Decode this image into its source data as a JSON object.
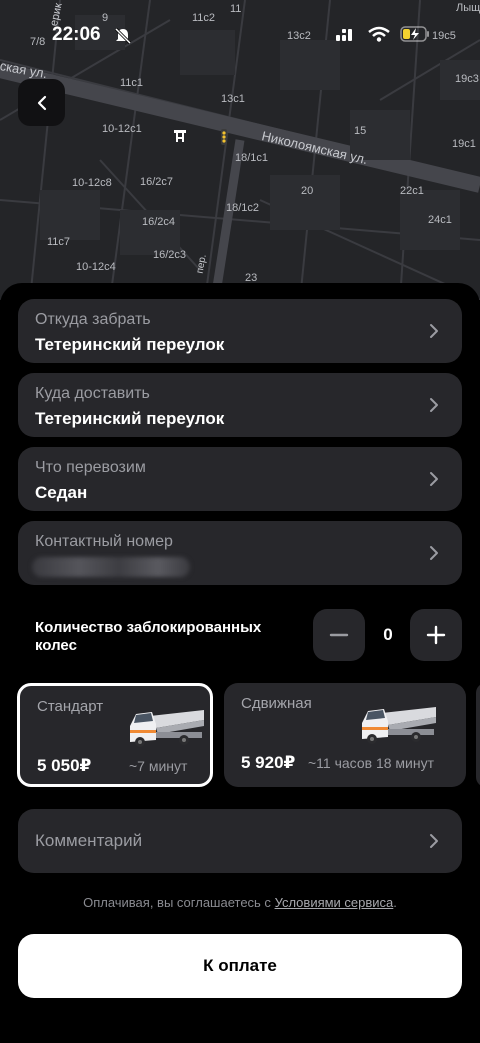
{
  "status_bar": {
    "time": "22:06"
  },
  "map": {
    "labels": [
      "7/8",
      "9",
      "11c2",
      "11",
      "13c2",
      "Лыщ",
      "19c5",
      "11c1",
      "13c1",
      "19c3",
      "10-12c1",
      "15",
      "19c1",
      "18/1c1",
      "10-12c8",
      "16/2c7",
      "20",
      "22c1",
      "18/1c2",
      "24c1",
      "16/2c4",
      "11c7",
      "16/2c3",
      "10-12c4",
      "23"
    ],
    "streets": [
      "Николоямская ул.",
      "ская ул.",
      "ерик",
      "пер."
    ]
  },
  "fields": {
    "from": {
      "label": "Откуда забрать",
      "value": "Тетеринский переулок"
    },
    "to": {
      "label": "Куда доставить",
      "value": "Тетеринский переулок"
    },
    "cargo": {
      "label": "Что перевозим",
      "value": "Седан"
    },
    "contact": {
      "label": "Контактный номер"
    }
  },
  "wheels": {
    "label": "Количество заблокированных колес",
    "count": "0"
  },
  "tariffs": [
    {
      "name": "Стандарт",
      "price": "5 050₽",
      "time": "~7 минут",
      "selected": true
    },
    {
      "name": "Сдвижная",
      "price": "5 920₽",
      "time": "~11 часов 18 минут",
      "selected": false
    }
  ],
  "comment": {
    "label": "Комментарий"
  },
  "terms": {
    "prefix": "Оплачивая, вы соглашаетесь с ",
    "link": "Условиями сервиса",
    "suffix": "."
  },
  "pay_button": "К оплате",
  "colors": {
    "background": "#000000",
    "card": "#27272b",
    "map": "#242528",
    "accent_truck": "#f08a34"
  }
}
